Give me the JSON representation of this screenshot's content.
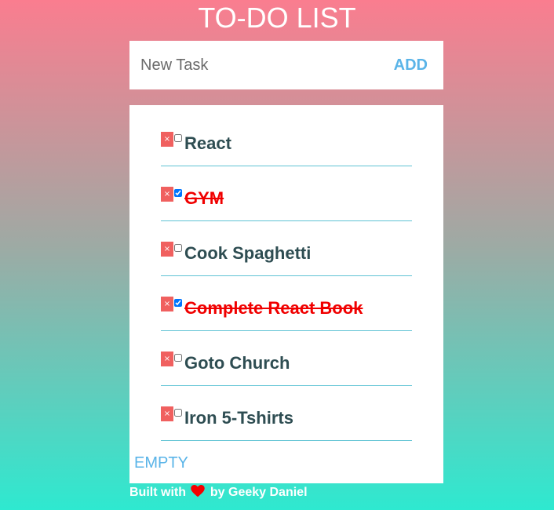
{
  "app": {
    "title": "TO-DO LIST"
  },
  "add_form": {
    "placeholder": "New Task",
    "value": "",
    "add_label": "ADD"
  },
  "tasks": [
    {
      "text": "React",
      "completed": false,
      "delete_symbol": "×"
    },
    {
      "text": "GYM",
      "completed": true,
      "delete_symbol": "×"
    },
    {
      "text": "Cook Spaghetti",
      "completed": false,
      "delete_symbol": "×"
    },
    {
      "text": "Complete React Book",
      "completed": true,
      "delete_symbol": "×"
    },
    {
      "text": "Goto Church",
      "completed": false,
      "delete_symbol": "×"
    },
    {
      "text": "Iron 5-Tshirts",
      "completed": false,
      "delete_symbol": "×"
    }
  ],
  "empty_label": "EMPTY",
  "footer": {
    "prefix": "Built with",
    "icon": "heart-icon",
    "suffix": "by Geeky Daniel"
  },
  "colors": {
    "gradient_top": "#fa7d8f",
    "gradient_bottom": "#2ee9d0",
    "accent": "#5ab4e8",
    "delete": "#f0605f",
    "done_text": "#f00000",
    "task_text": "#2e4d52",
    "divider": "#5fc3d4"
  }
}
